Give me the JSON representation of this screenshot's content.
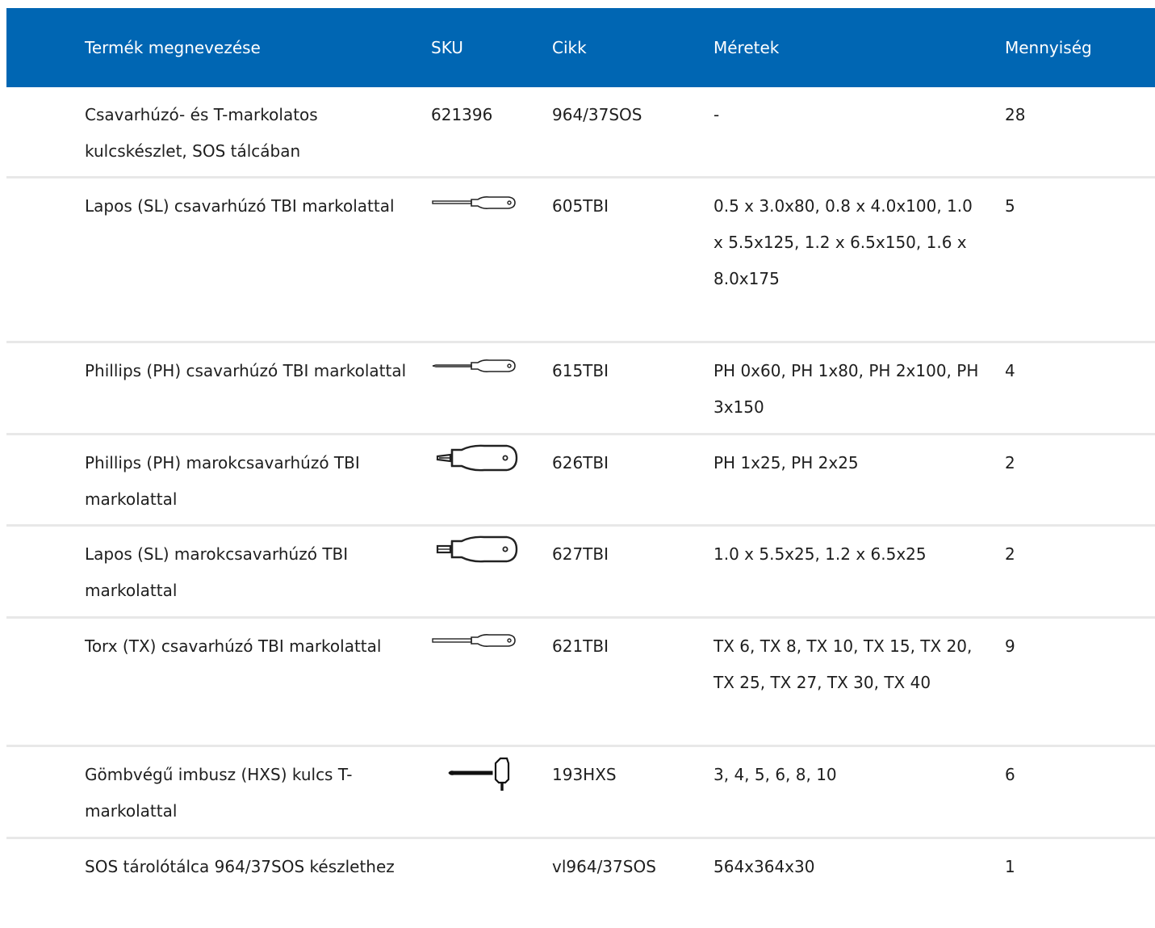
{
  "headers": {
    "name": "Termék megnevezése",
    "sku": "SKU",
    "cikk": "Cikk",
    "dim": "Méretek",
    "qty": "Mennyiség"
  },
  "rows": [
    {
      "name": "Csavarhúzó- és T-markolatos kulcskészlet, SOS tálcában",
      "sku": "621396",
      "cikk": "964/37SOS",
      "dim": "-",
      "qty": "28",
      "icon": "none"
    },
    {
      "name": "Lapos (SL) csavarhúzó TBI markolattal",
      "sku": "",
      "cikk": "605TBI",
      "dim": "0.5 x 3.0x80, 0.8 x 4.0x100, 1.0 x 5.5x125, 1.2 x 6.5x150, 1.6 x 8.0x175",
      "qty": "5",
      "icon": "slotted-screwdriver-icon"
    },
    {
      "name": "Phillips (PH) csavarhúzó TBI markolattal",
      "sku": "",
      "cikk": "615TBI",
      "dim": "PH 0x60, PH 1x80, PH 2x100, PH 3x150",
      "qty": "4",
      "icon": "phillips-screwdriver-icon"
    },
    {
      "name": "Phillips (PH) marokcsavarhúzó TBI markolattal",
      "sku": "",
      "cikk": "626TBI",
      "dim": "PH 1x25, PH 2x25",
      "qty": "2",
      "icon": "stubby-phillips-screwdriver-icon"
    },
    {
      "name": "Lapos (SL) marokcsavarhúzó TBI markolattal",
      "sku": "",
      "cikk": "627TBI",
      "dim": "1.0 x 5.5x25, 1.2 x 6.5x25",
      "qty": "2",
      "icon": "stubby-slotted-screwdriver-icon"
    },
    {
      "name": "Torx (TX) csavarhúzó TBI markolattal",
      "sku": "",
      "cikk": "621TBI",
      "dim": "TX 6, TX 8, TX 10, TX 15, TX 20, TX 25, TX 27, TX 30, TX 40",
      "qty": "9",
      "icon": "torx-screwdriver-icon"
    },
    {
      "name": "Gömbvégű imbusz (HXS) kulcs T-markolattal",
      "sku": "",
      "cikk": "193HXS",
      "dim": "3, 4, 5, 6, 8, 10",
      "qty": "6",
      "icon": "t-handle-hex-key-icon"
    },
    {
      "name": "SOS tárolótálca 964/37SOS készlethez",
      "sku": "",
      "cikk": "vl964/37SOS",
      "dim": "564x364x30",
      "qty": "1",
      "icon": "none"
    }
  ]
}
